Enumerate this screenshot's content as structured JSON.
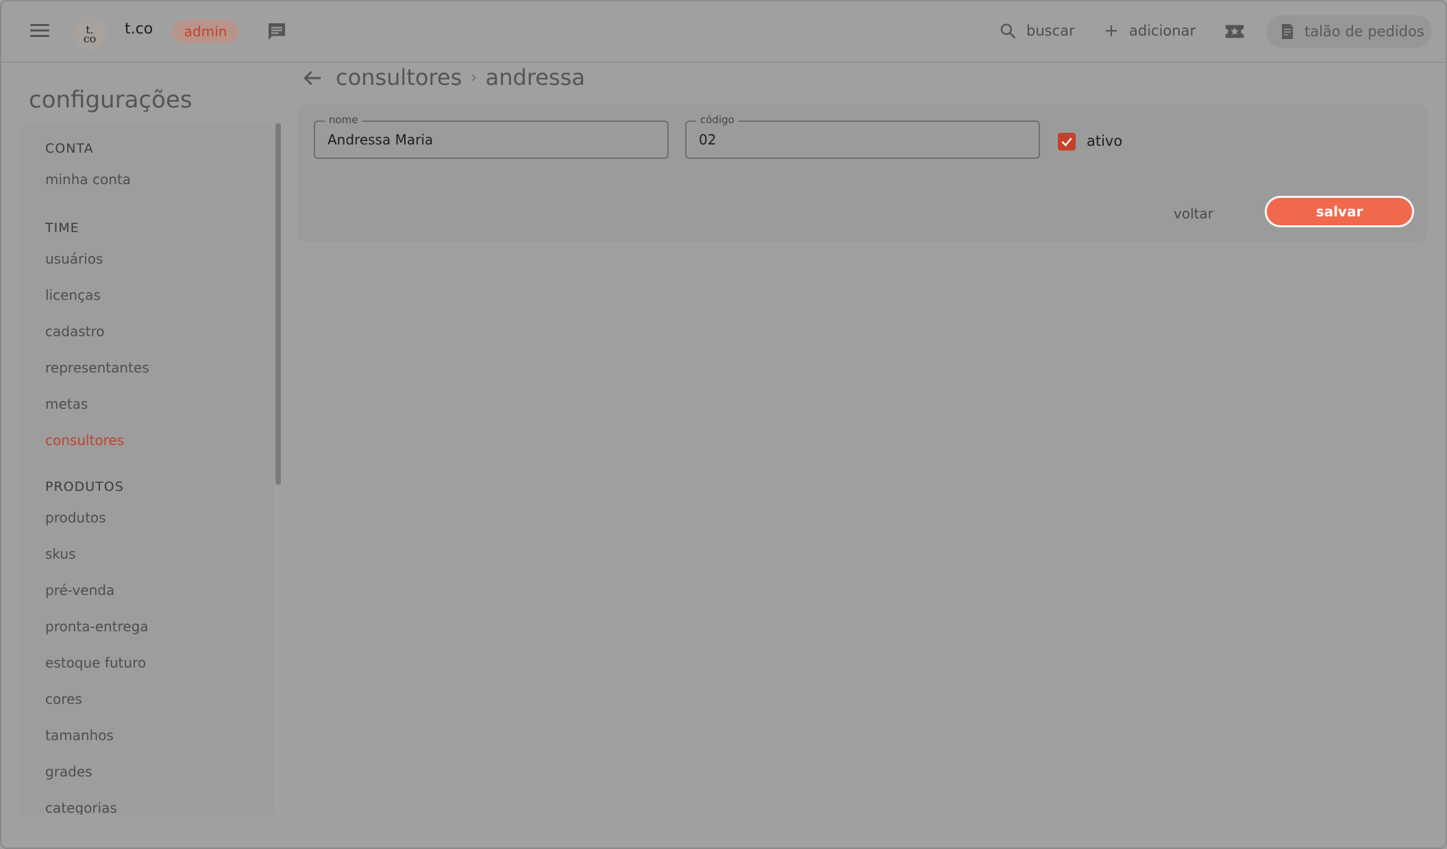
{
  "header": {
    "logo_text": "t.\nco",
    "brand": "t.co",
    "role_badge": "admin",
    "search_label": "buscar",
    "add_label": "adicionar",
    "talao_label": "talão de pedidos"
  },
  "sidebar": {
    "title": "configurações",
    "sections": [
      {
        "header": "CONTA",
        "items": [
          "minha conta"
        ]
      },
      {
        "header": "TIME",
        "items": [
          "usuários",
          "licenças",
          "cadastro",
          "representantes",
          "metas",
          "consultores"
        ]
      },
      {
        "header": "PRODUTOS",
        "items": [
          "produtos",
          "skus",
          "pré-venda",
          "pronta-entrega",
          "estoque futuro",
          "cores",
          "tamanhos",
          "grades",
          "categorias"
        ]
      }
    ],
    "active_item": "consultores"
  },
  "breadcrumb": {
    "parent": "consultores",
    "separator": "›",
    "current": "andressa"
  },
  "form": {
    "nome_label": "nome",
    "nome_value": "Andressa Maria",
    "codigo_label": "código",
    "codigo_value": "02",
    "ativo_label": "ativo",
    "ativo_checked": true,
    "voltar_label": "voltar",
    "salvar_label": "salvar"
  },
  "colors": {
    "accent": "#f0694c",
    "accent_dark": "#c2432b"
  }
}
